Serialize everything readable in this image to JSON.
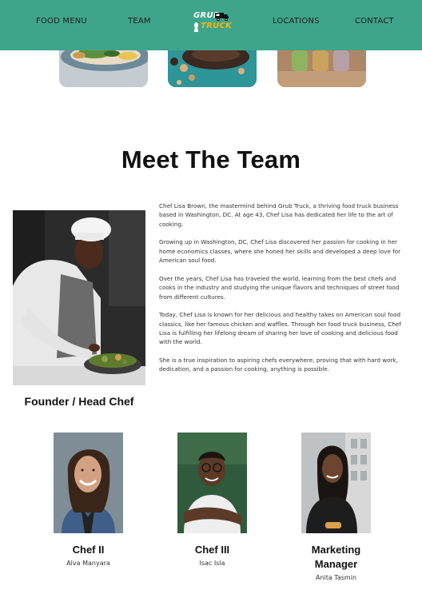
{
  "nav": {
    "items": [
      "FOOD MENU",
      "TEAM",
      "LOCATIONS",
      "CONTACT"
    ],
    "logo_line1": "GRUB",
    "logo_line2": "TRUCK",
    "bg_color": "#3fa58a"
  },
  "section": {
    "title": "Meet The Team"
  },
  "founder": {
    "role": "Founder / Head Chef",
    "bio": [
      "Chef Lisa Brown, the mastermind behind Grub Truck, a thriving food truck business based in Washington, DC. At age 43, Chef Lisa has dedicated her life to the art of cooking.",
      "Growing up in Washington, DC, Chef Lisa discovered her passion for cooking in her home economics classes, where she honed her skills and developed a deep love for American soul food.",
      "Over the years, Chef Lisa has traveled the world, learning from the best chefs and cooks in the industry and studying the unique flavors and techniques of street food from different cultures.",
      "Today, Chef Lisa is known for her delicious and healthy takes on American soul food classics, like her famous chicken and waffles. Through her food truck business, Chef Lisa is fulfilling her lifelong dream of sharing her love of cooking and delicious food with the world.",
      "She is a true inspiration to aspiring chefs everywhere, proving that with hard work, dedication, and a passion for cooking, anything is possible."
    ]
  },
  "team": [
    {
      "role": "Chef II",
      "name": "Alva Manyara"
    },
    {
      "role": "Chef III",
      "name": "Isac Isla"
    },
    {
      "role_line1": "Marketing",
      "role_line2": "Manager",
      "name": "Anita Tasmin"
    }
  ]
}
